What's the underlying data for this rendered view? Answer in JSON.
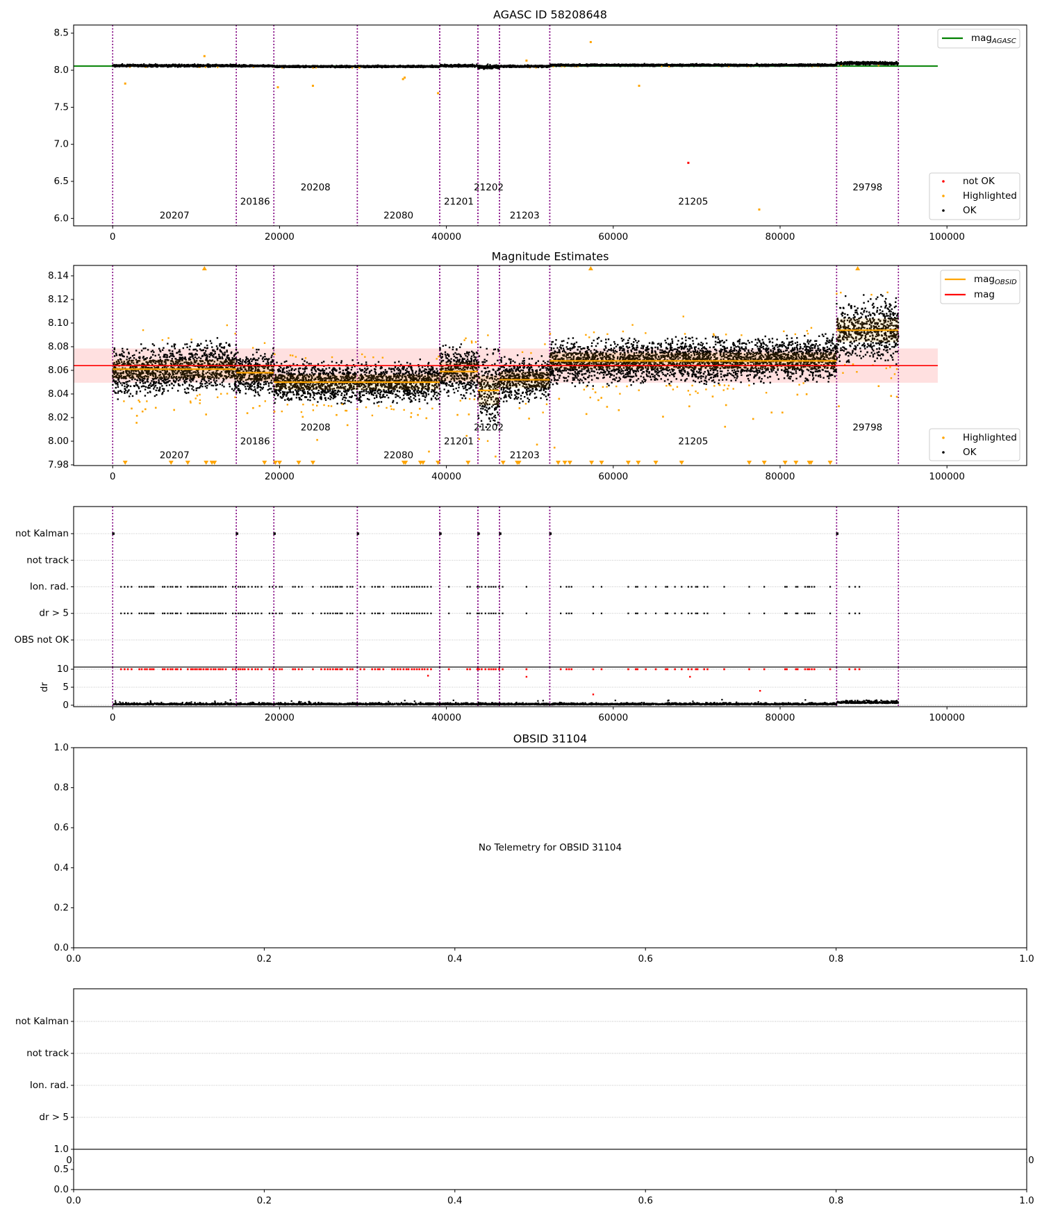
{
  "observations": [
    {
      "obsid": "20207",
      "start": 0,
      "end": 14820,
      "mag_obsid": 8.061,
      "std": 0.008
    },
    {
      "obsid": "20186",
      "start": 14820,
      "end": 19320,
      "mag_obsid": 8.058,
      "std": 0.007
    },
    {
      "obsid": "20208",
      "start": 19320,
      "end": 29320,
      "mag_obsid": 8.05,
      "std": 0.0065
    },
    {
      "obsid": "22080",
      "start": 29320,
      "end": 39200,
      "mag_obsid": 8.05,
      "std": 0.0065
    },
    {
      "obsid": "21201",
      "start": 39200,
      "end": 43780,
      "mag_obsid": 8.059,
      "std": 0.008
    },
    {
      "obsid": "21202",
      "start": 43780,
      "end": 46370,
      "mag_obsid": 8.043,
      "std": 0.0125
    },
    {
      "obsid": "21203",
      "start": 46370,
      "end": 52390,
      "mag_obsid": 8.052,
      "std": 0.007
    },
    {
      "obsid": "21205",
      "start": 52390,
      "end": 86770,
      "mag_obsid": 8.068,
      "std": 0.007
    },
    {
      "obsid": "29798",
      "start": 86770,
      "end": 94180,
      "mag_obsid": 8.094,
      "std": 0.01
    }
  ],
  "colors": {
    "boundary": "#800080",
    "agasc": "#008000",
    "mag_obsid": "#ffa500",
    "mag": "#ff0000",
    "highlighted": "#ffa500",
    "ok": "#000000",
    "not_ok": "#ff0000",
    "grid": "#b0b0b0"
  },
  "chart_data": [
    {
      "type": "scatter",
      "title": "AGASC ID 58208648",
      "xlim": [
        -4680,
        109560
      ],
      "ylim": [
        5.9,
        8.61
      ],
      "xticks": [
        "0",
        "20000",
        "40000",
        "60000",
        "80000",
        "100000"
      ],
      "yticks": [
        "6.0",
        "6.5",
        "7.0",
        "7.5",
        "8.0",
        "8.5"
      ],
      "mag_agasc": 8.055,
      "line_end": 98900,
      "highlighted_points": [
        [
          1500,
          7.82
        ],
        [
          11000,
          8.19
        ],
        [
          19800,
          7.77
        ],
        [
          24000,
          7.79
        ],
        [
          34800,
          7.88
        ],
        [
          35000,
          7.9
        ],
        [
          39000,
          7.69
        ],
        [
          49600,
          8.13
        ],
        [
          57300,
          8.38
        ],
        [
          63100,
          7.79
        ],
        [
          77500,
          6.12
        ]
      ],
      "not_ok_points": [
        [
          69000,
          6.75
        ]
      ],
      "legend_line": {
        "label": "mag",
        "sub": "AGASC"
      },
      "legend_points": [
        "not OK",
        "Highlighted",
        "OK"
      ]
    },
    {
      "type": "scatter",
      "title": "Magnitude Estimates",
      "xlim": [
        -4680,
        109560
      ],
      "ylim": [
        7.9794,
        8.1488
      ],
      "xticks": [
        "0",
        "20000",
        "40000",
        "60000",
        "80000",
        "100000"
      ],
      "yticks": [
        "7.98",
        "8.00",
        "8.02",
        "8.04",
        "8.06",
        "8.08",
        "8.10",
        "8.12",
        "8.14"
      ],
      "mag": 8.064,
      "mag_std": 0.0145,
      "line_end": 98900,
      "below_range_x": [
        1500,
        7000,
        9000,
        11200,
        11900,
        12200,
        18200,
        19500,
        20000,
        22300,
        24000,
        34900,
        35100,
        36900,
        37200,
        39000,
        42600,
        46800,
        48500,
        48700,
        53400,
        54200,
        54800,
        57400,
        58600,
        61800,
        63000,
        65100,
        68200,
        76300,
        78100,
        80600,
        81900,
        83500,
        83700,
        86000
      ],
      "above_range_x": [
        11000,
        57300,
        89300
      ],
      "legend_lines": [
        {
          "label": "mag",
          "sub": "OBSID"
        },
        {
          "label": "mag",
          "sub": ""
        }
      ],
      "legend_points": [
        "Highlighted",
        "OK"
      ]
    },
    {
      "type": "scatter",
      "xlim": [
        -4680,
        109560
      ],
      "xticks": [
        "0",
        "20000",
        "40000",
        "60000",
        "80000",
        "100000"
      ],
      "flag_rows": [
        "OBS not OK",
        "dr > 5",
        "Ion. rad.",
        "not track",
        "not Kalman"
      ],
      "not_kalman_x": [
        0,
        14820,
        19320,
        29320,
        39200,
        43780,
        46370,
        52390,
        86770
      ],
      "flag_x_ranges": [
        [
          1000,
          2400
        ],
        [
          3200,
          5000
        ],
        [
          6000,
          8400
        ],
        [
          9000,
          13600
        ],
        [
          14400,
          18000
        ],
        [
          18800,
          20600
        ],
        [
          21600,
          22800
        ],
        [
          24000,
          24000
        ],
        [
          25000,
          27500
        ],
        [
          28100,
          28900
        ],
        [
          29700,
          30300
        ],
        [
          31100,
          32700
        ],
        [
          33500,
          38300
        ],
        [
          40300,
          40300
        ],
        [
          42500,
          43100
        ],
        [
          43700,
          47000
        ]
      ],
      "flag_x": [
        49600,
        53700,
        54400,
        54700,
        55000,
        57600,
        58600,
        61800,
        62700,
        62900,
        63900,
        65100,
        66300,
        66500,
        67400,
        68200,
        69000,
        69400,
        69900,
        70100,
        70900,
        71300,
        73300,
        76300,
        78100,
        80600,
        80800,
        81900,
        82100,
        83000,
        83300,
        83500,
        83800,
        84100,
        86000,
        88300,
        89000,
        89500
      ],
      "dr_ylabel": "dr",
      "dr_ylim": [
        -0.4,
        10.6
      ],
      "dr_yticks": [
        "0",
        "5",
        "10"
      ],
      "dr_red_points": [
        [
          37800,
          8.2
        ],
        [
          49600,
          7.9
        ],
        [
          69200,
          7.9
        ],
        [
          57600,
          3.0
        ],
        [
          77600,
          4.0
        ]
      ]
    },
    {
      "type": "scatter",
      "title": "OBSID 31104",
      "message": "No Telemetry for OBSID 31104",
      "xlim": [
        0,
        1
      ],
      "ylim": [
        0,
        1
      ],
      "xticks": [
        "0.0",
        "0.2",
        "0.4",
        "0.6",
        "0.8",
        "1.0"
      ],
      "yticks": [
        "0.0",
        "0.2",
        "0.4",
        "0.6",
        "0.8",
        "1.0"
      ]
    },
    {
      "type": "scatter",
      "flag_rows": [
        "dr > 5",
        "Ion. rad.",
        "not track",
        "not Kalman"
      ],
      "xticks": [
        "0.0",
        "0.2",
        "0.4",
        "0.6",
        "0.8",
        "1.0"
      ],
      "hidden_xticks": [
        "0.0",
        "1.0"
      ],
      "sub_yticks": [
        "0.0",
        "0.5",
        "1.0"
      ]
    }
  ]
}
